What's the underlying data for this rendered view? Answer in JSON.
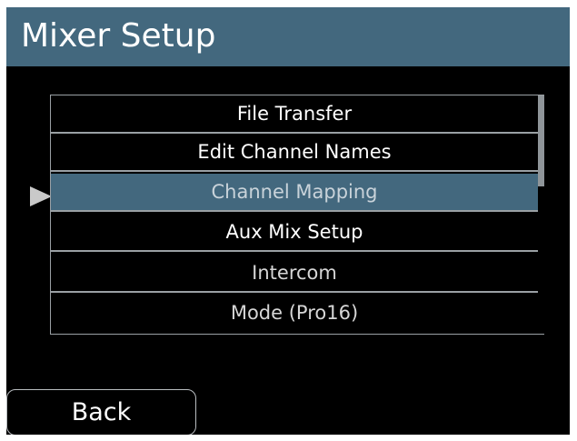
{
  "header": {
    "title": "Mixer Setup"
  },
  "menu": {
    "items": [
      {
        "label": "File Transfer",
        "text_color": "#ffffff"
      },
      {
        "label": "Edit Channel Names",
        "text_color": "#ffffff"
      },
      {
        "label": "Channel Mapping",
        "text_color": "#c9d3da",
        "selected": true
      },
      {
        "label": "Aux Mix Setup",
        "text_color": "#ffffff"
      },
      {
        "label": "Intercom",
        "text_color": "#d6d6d6"
      },
      {
        "label": "Mode  (Pro16)",
        "text_color": "#d6d6d6"
      }
    ],
    "selection_indicator_icon": "right-pointing-triangle"
  },
  "footer": {
    "back_label": "Back"
  },
  "colors": {
    "accent": "#43687e",
    "background": "#000000",
    "border": "#9aa0a4"
  }
}
